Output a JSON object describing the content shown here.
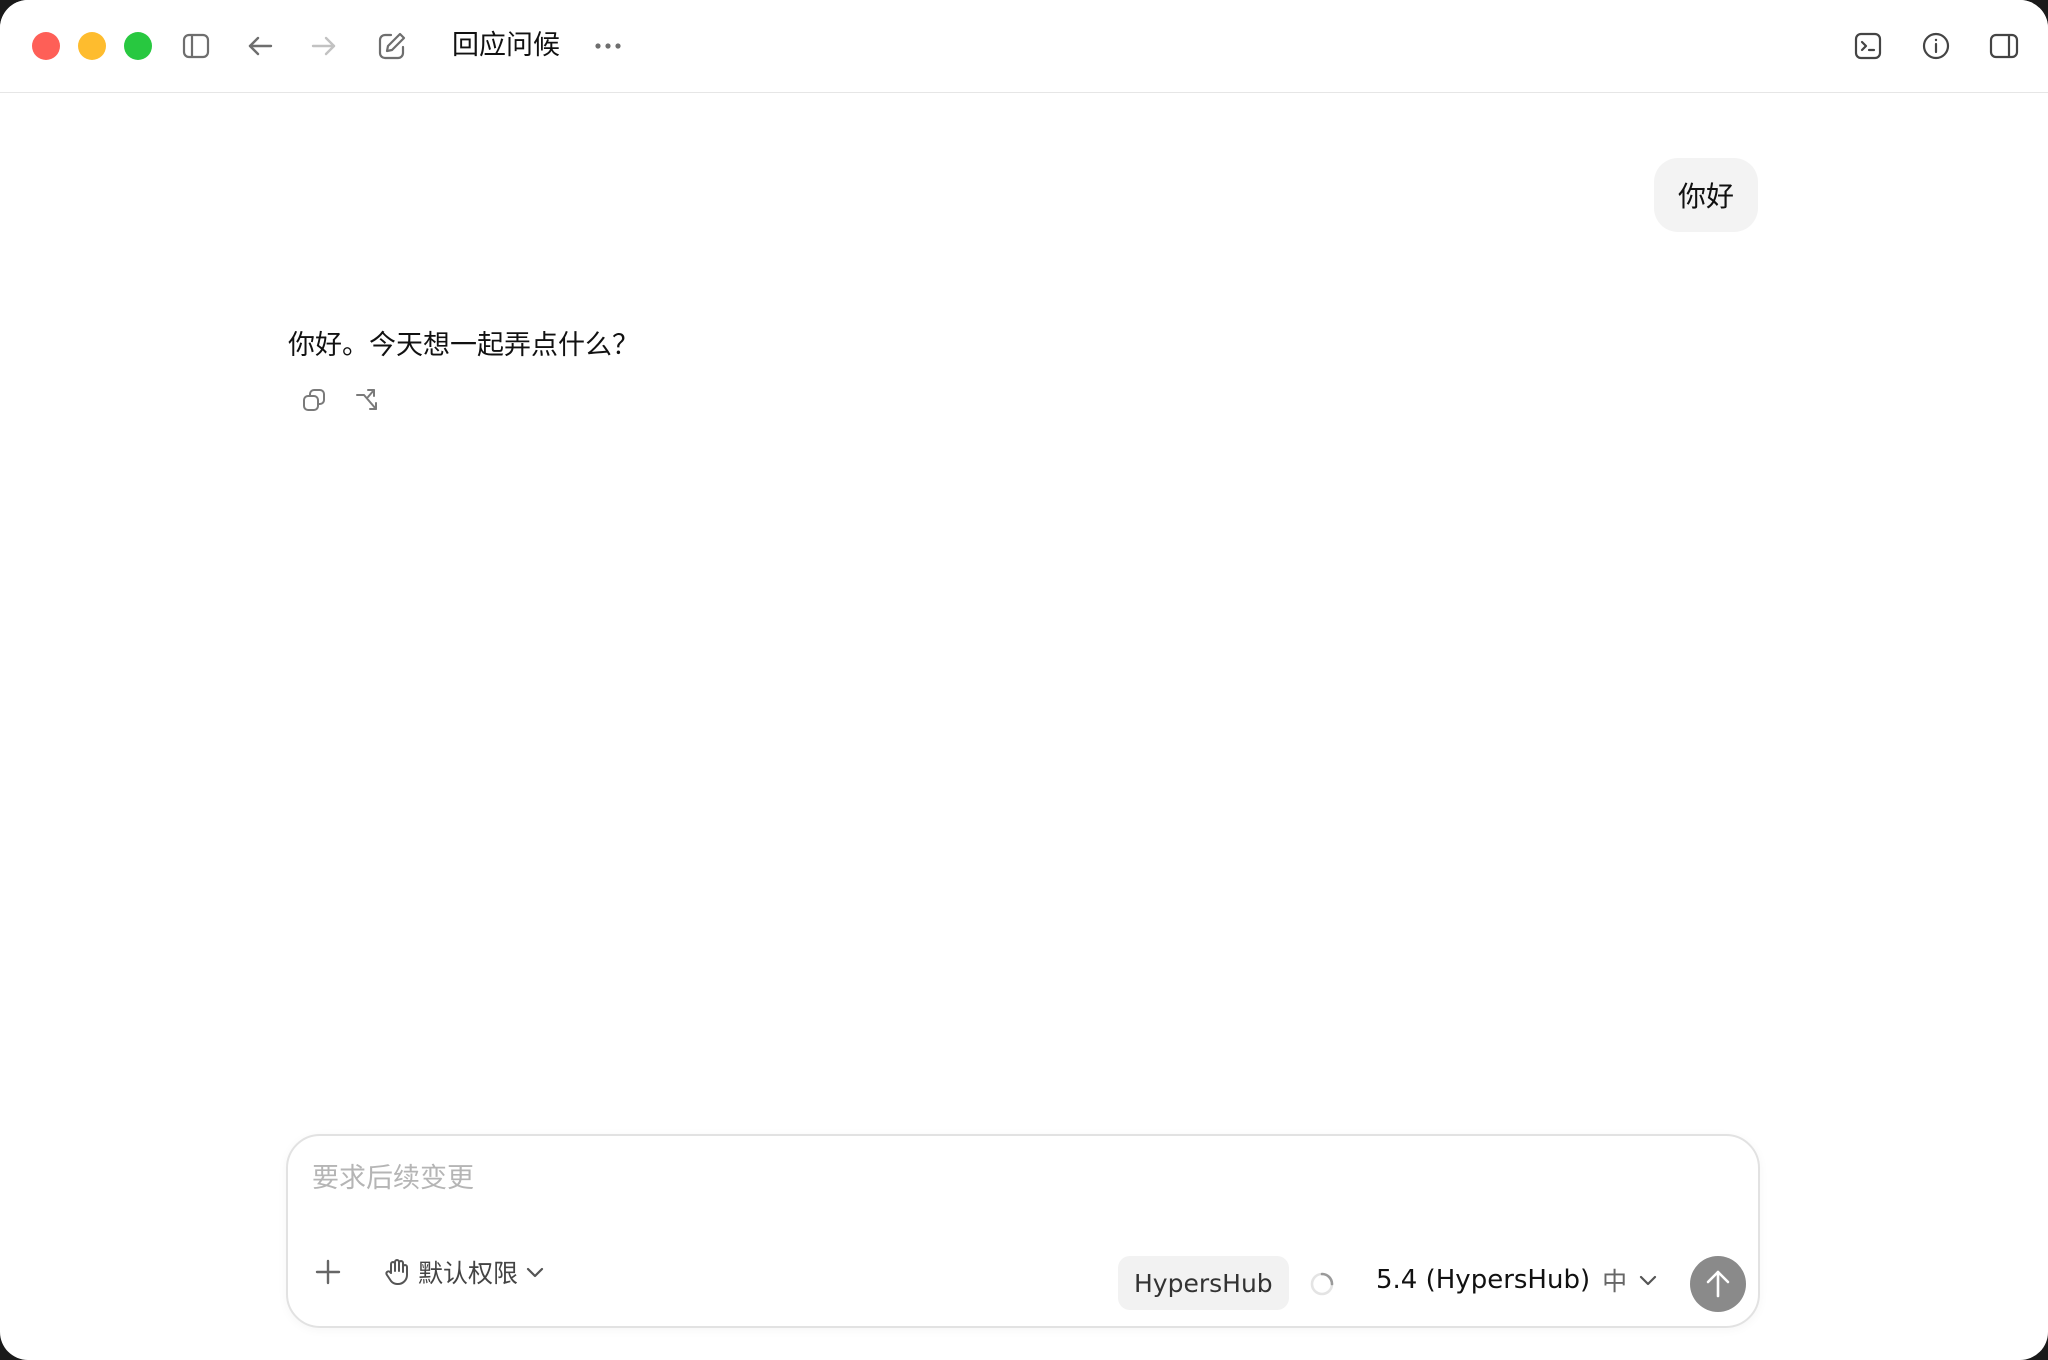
{
  "window": {
    "title": "回应问候"
  },
  "conversation": {
    "user_message": "你好",
    "assistant_message": "你好。今天想一起弄点什么？"
  },
  "composer": {
    "placeholder": "要求后续变更",
    "permission_label": "默认权限",
    "hub_chip_label": "HypersHub",
    "model_label": "5.4 (HypersHub)",
    "reasoning_level": "中"
  },
  "colors": {
    "close": "#fe5f57",
    "minimize": "#febc2e",
    "maximize": "#28c840",
    "send_button": "#8a8a8a",
    "user_bubble": "#f3f3f3"
  },
  "icons": {
    "sidebar": "sidebar-toggle-icon",
    "back": "arrow-left-icon",
    "forward": "arrow-right-icon",
    "new_chat": "compose-icon",
    "more": "ellipsis-icon",
    "terminal": "terminal-icon",
    "info": "info-icon",
    "right_panel": "right-panel-icon",
    "copy": "copy-icon",
    "branch": "branch-icon",
    "add": "plus-icon",
    "permission": "hand-icon",
    "chevron": "chevron-down-icon",
    "send": "arrow-up-icon"
  }
}
